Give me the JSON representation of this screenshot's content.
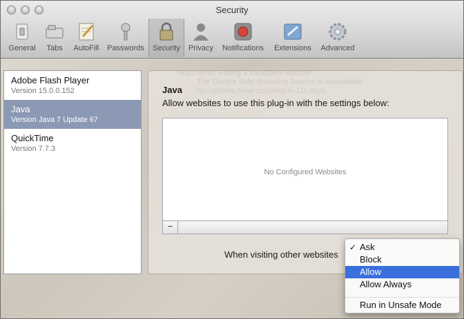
{
  "window": {
    "title": "Security"
  },
  "toolbar": {
    "items": [
      {
        "label": "General",
        "icon": "general-switch-icon"
      },
      {
        "label": "Tabs",
        "icon": "tabs-icon"
      },
      {
        "label": "AutoFill",
        "icon": "autofill-icon"
      },
      {
        "label": "Passwords",
        "icon": "key-icon"
      },
      {
        "label": "Security",
        "icon": "lock-icon",
        "active": true
      },
      {
        "label": "Privacy",
        "icon": "privacy-person-icon"
      },
      {
        "label": "Notifications",
        "icon": "notifications-icon"
      },
      {
        "label": "Extensions",
        "icon": "extensions-puzzle-icon"
      },
      {
        "label": "Advanced",
        "icon": "gear-icon"
      }
    ]
  },
  "plugins": [
    {
      "name": "Adobe Flash Player",
      "version": "Version 15.0.0.152"
    },
    {
      "name": "Java",
      "version": "Version Java 7 Update 67",
      "selected": true
    },
    {
      "name": "QuickTime",
      "version": "Version 7.7.3"
    }
  ],
  "detail": {
    "title": "Java",
    "description": "Allow websites to use this plug-in with the settings below:",
    "empty_text": "No Configured Websites",
    "minus_label": "−",
    "visit_label": "When visiting other websites"
  },
  "menu": {
    "options": [
      "Ask",
      "Block",
      "Allow",
      "Allow Always",
      "Run in Unsafe Mode"
    ],
    "checked": "Ask",
    "highlighted": "Allow"
  },
  "background_ghost": {
    "warn": "Warn when visiting a fraudulent website",
    "service": "The Google Safe Browsing Service is unavailable.",
    "updates": "No updates have occurred in 111 days."
  },
  "colors": {
    "selection": "#8b99b5",
    "menu_highlight": "#3a6fdc"
  }
}
